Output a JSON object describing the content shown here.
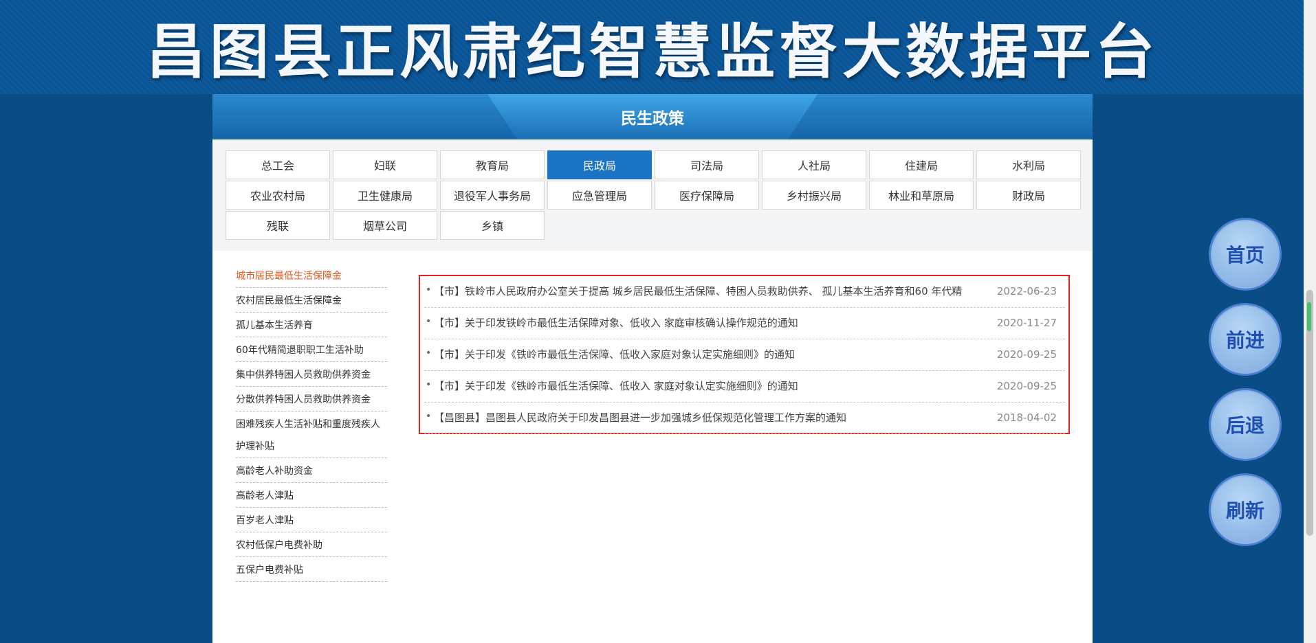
{
  "banner": {
    "title": "昌图县正风肃纪智慧监督大数据平台"
  },
  "section": {
    "title": "民生政策"
  },
  "departments": [
    {
      "label": "总工会",
      "active": false
    },
    {
      "label": "妇联",
      "active": false
    },
    {
      "label": "教育局",
      "active": false
    },
    {
      "label": "民政局",
      "active": true
    },
    {
      "label": "司法局",
      "active": false
    },
    {
      "label": "人社局",
      "active": false
    },
    {
      "label": "住建局",
      "active": false
    },
    {
      "label": "水利局",
      "active": false
    },
    {
      "label": "农业农村局",
      "active": false
    },
    {
      "label": "卫生健康局",
      "active": false
    },
    {
      "label": "退役军人事务局",
      "active": false
    },
    {
      "label": "应急管理局",
      "active": false
    },
    {
      "label": "医疗保障局",
      "active": false
    },
    {
      "label": "乡村振兴局",
      "active": false
    },
    {
      "label": "林业和草原局",
      "active": false
    },
    {
      "label": "财政局",
      "active": false
    },
    {
      "label": "残联",
      "active": false
    },
    {
      "label": "烟草公司",
      "active": false
    },
    {
      "label": "乡镇",
      "active": false
    }
  ],
  "sidebar": {
    "items": [
      {
        "label": "城市居民最低生活保障金",
        "active": true
      },
      {
        "label": "农村居民最低生活保障金",
        "active": false
      },
      {
        "label": "孤儿基本生活养育",
        "active": false
      },
      {
        "label": "60年代精简退职职工生活补助",
        "active": false
      },
      {
        "label": "集中供养特困人员救助供养资金",
        "active": false
      },
      {
        "label": "分散供养特困人员救助供养资金",
        "active": false
      },
      {
        "label": "困难残疾人生活补贴和重度残疾人护理补贴",
        "active": false
      },
      {
        "label": "高龄老人补助资金",
        "active": false
      },
      {
        "label": "高龄老人津贴",
        "active": false
      },
      {
        "label": "百岁老人津贴",
        "active": false
      },
      {
        "label": "农村低保户电费补助",
        "active": false
      },
      {
        "label": "五保户电费补贴",
        "active": false
      }
    ]
  },
  "news": [
    {
      "title": "【市】铁岭市人民政府办公室关于提高 城乡居民最低生活保障、特困人员救助供养、 孤儿基本生活养育和60 年代精",
      "date": "2022-06-23"
    },
    {
      "title": "【市】关于印发铁岭市最低生活保障对象、低收入 家庭审核确认操作规范的通知",
      "date": "2020-11-27"
    },
    {
      "title": "【市】关于印发《铁岭市最低生活保障、低收入家庭对象认定实施细则》的通知",
      "date": "2020-09-25"
    },
    {
      "title": "【市】关于印发《铁岭市最低生活保障、低收入 家庭对象认定实施细则》的通知",
      "date": "2020-09-25"
    },
    {
      "title": "【昌图县】昌图县人民政府关于印发昌图县进一步加强城乡低保规范化管理工作方案的通知",
      "date": "2018-04-02"
    }
  ],
  "floating_nav": {
    "home": "首页",
    "forward": "前进",
    "back": "后退",
    "refresh": "刷新"
  }
}
